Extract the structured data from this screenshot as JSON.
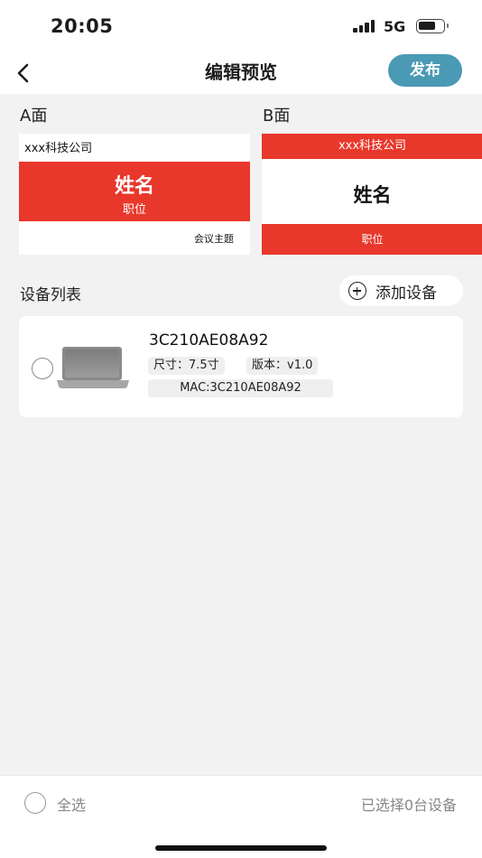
{
  "status_bar": {
    "time": "20:05",
    "network": "5G",
    "icons": [
      "signal-icon",
      "battery-icon"
    ]
  },
  "nav": {
    "title": "编辑预览",
    "back_icon": "chevron-left-icon",
    "publish_label": "发布"
  },
  "colors": {
    "accent_red": "#e8382b",
    "publish_blue": "#4a99b5",
    "background": "#f1f2f1"
  },
  "preview": {
    "side_a": {
      "label": "A面",
      "company": "xxx科技公司",
      "name": "姓名",
      "position": "职位",
      "topic": "会议主题"
    },
    "side_b": {
      "label": "B面",
      "company": "xxx科技公司",
      "name": "姓名",
      "position": "职位"
    }
  },
  "devices": {
    "title": "设备列表",
    "add_label": "添加设备",
    "add_icon": "plus-circle-icon",
    "items": [
      {
        "name": "3C210AE08A92",
        "size": "尺寸：7.5寸",
        "version": "版本：v1.0",
        "mac": "MAC:3C210AE08A92",
        "image_icon": "laptop-icon",
        "selected": false
      }
    ]
  },
  "footer": {
    "select_all": "全选",
    "selected_count": "已选择0台设备"
  }
}
